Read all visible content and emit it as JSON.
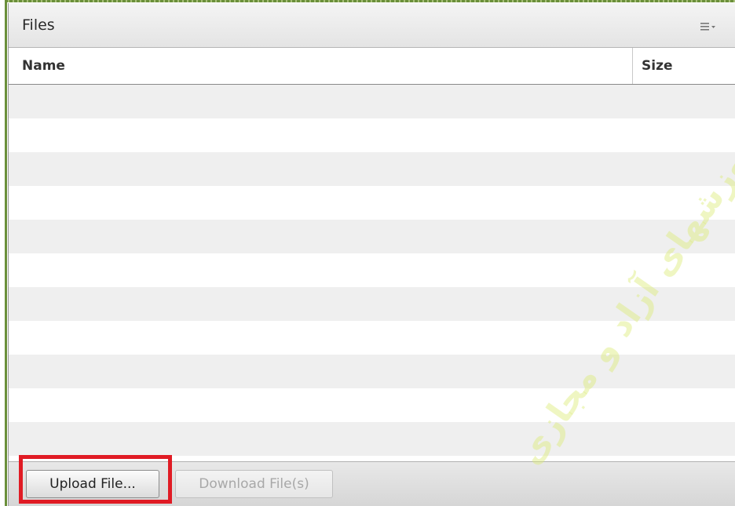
{
  "panel": {
    "title": "Files",
    "menu_icon": "list-menu-icon"
  },
  "table": {
    "columns": [
      "Name",
      "Size"
    ],
    "rows": []
  },
  "footer": {
    "upload_label": "Upload File...",
    "download_label": "Download File(s)"
  },
  "watermark": {
    "text": "آموزشهای آزاد و مجازی"
  },
  "colors": {
    "highlight": "#e01b24",
    "frame_border": "#6a8f3a",
    "row_alt": "#efefef"
  }
}
